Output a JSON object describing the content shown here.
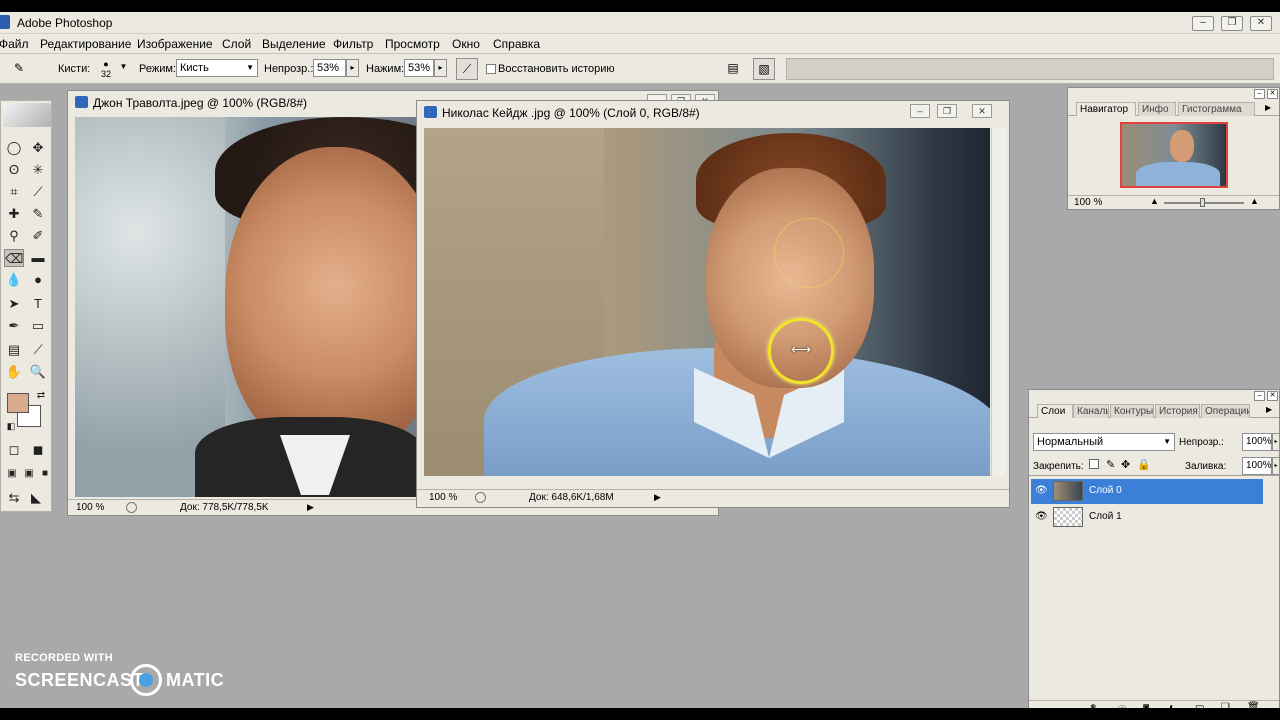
{
  "app": {
    "title": "Adobe Photoshop",
    "win_buttons": [
      "–",
      "❐",
      "✕"
    ]
  },
  "menu": [
    "Файл",
    "Редактирование",
    "Изображение",
    "Слой",
    "Выделение",
    "Фильтр",
    "Просмотр",
    "Окно",
    "Справка"
  ],
  "options": {
    "brush_label": "Кисти:",
    "brush_size": "32",
    "mode_label": "Режим:",
    "mode_value": "Кисть",
    "opacity_label": "Непрозр.:",
    "opacity_value": "53%",
    "flow_label": "Нажим:",
    "flow_value": "53%",
    "restore_history_label": "Восстановить историю"
  },
  "doc1": {
    "title": "Джон Траволта.jpeg @ 100% (RGB/8#)",
    "zoom": "100 %",
    "doc_info": "Док: 778,5K/778,5K"
  },
  "doc2": {
    "title": "Николас Кейдж .jpg @ 100% (Слой 0, RGB/8#)",
    "zoom": "100 %",
    "doc_info": "Док: 648,6K/1,68M"
  },
  "navigator": {
    "tabs": [
      "Навигатор",
      "Инфо",
      "Гистограмма"
    ],
    "zoom": "100 %"
  },
  "layers": {
    "tabs": [
      "Слои",
      "Каналы",
      "Контуры",
      "История",
      "Операции"
    ],
    "blend_mode": "Нормальный",
    "opacity_label": "Непрозр.:",
    "opacity_value": "100%",
    "lock_label": "Закрепить:",
    "fill_label": "Заливка:",
    "fill_value": "100%",
    "items": [
      {
        "name": "Слой 0",
        "selected": true
      },
      {
        "name": "Слой 1",
        "selected": false
      }
    ]
  },
  "watermark": {
    "line1": "RECORDED WITH",
    "line2a": "SCREENCAST",
    "line2b": "MATIC"
  }
}
